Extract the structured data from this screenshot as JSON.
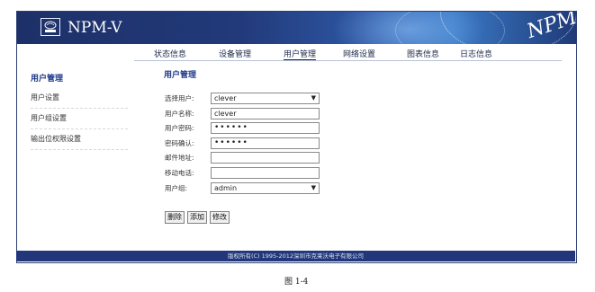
{
  "header": {
    "brand": "NPM-V",
    "logo_icon": "network-device-logo-icon",
    "watermark_text": "NPM",
    "banner_color": "#22367a"
  },
  "nav": {
    "items": [
      {
        "label": "状态信息"
      },
      {
        "label": "设备管理"
      },
      {
        "label": "用户管理",
        "active": true
      },
      {
        "label": "网络设置"
      },
      {
        "label": "图表信息"
      },
      {
        "label": "日志信息"
      }
    ]
  },
  "sidebar": {
    "title": "用户管理",
    "items": [
      {
        "label": "用户设置"
      },
      {
        "label": "用户组设置"
      },
      {
        "label": "输出位权限设置"
      }
    ]
  },
  "main": {
    "title": "用户管理",
    "fields": {
      "select_user": {
        "label": "选择用户:",
        "value": "clever"
      },
      "user_name": {
        "label": "用户名称:",
        "value": "clever"
      },
      "password": {
        "label": "用户密码:",
        "value": "••••••"
      },
      "confirm": {
        "label": "密码确认:",
        "value": "••••••"
      },
      "email": {
        "label": "邮件地址:",
        "value": ""
      },
      "mobile": {
        "label": "移动电话:",
        "value": ""
      },
      "group": {
        "label": "用户组:",
        "value": "admin"
      }
    },
    "buttons": {
      "delete": "删除",
      "add": "添加",
      "modify": "修改"
    }
  },
  "footer": {
    "copyright": "版权所有(C) 1995-2012深圳市克莱沃电子有限公司"
  },
  "caption": "图 1-4"
}
